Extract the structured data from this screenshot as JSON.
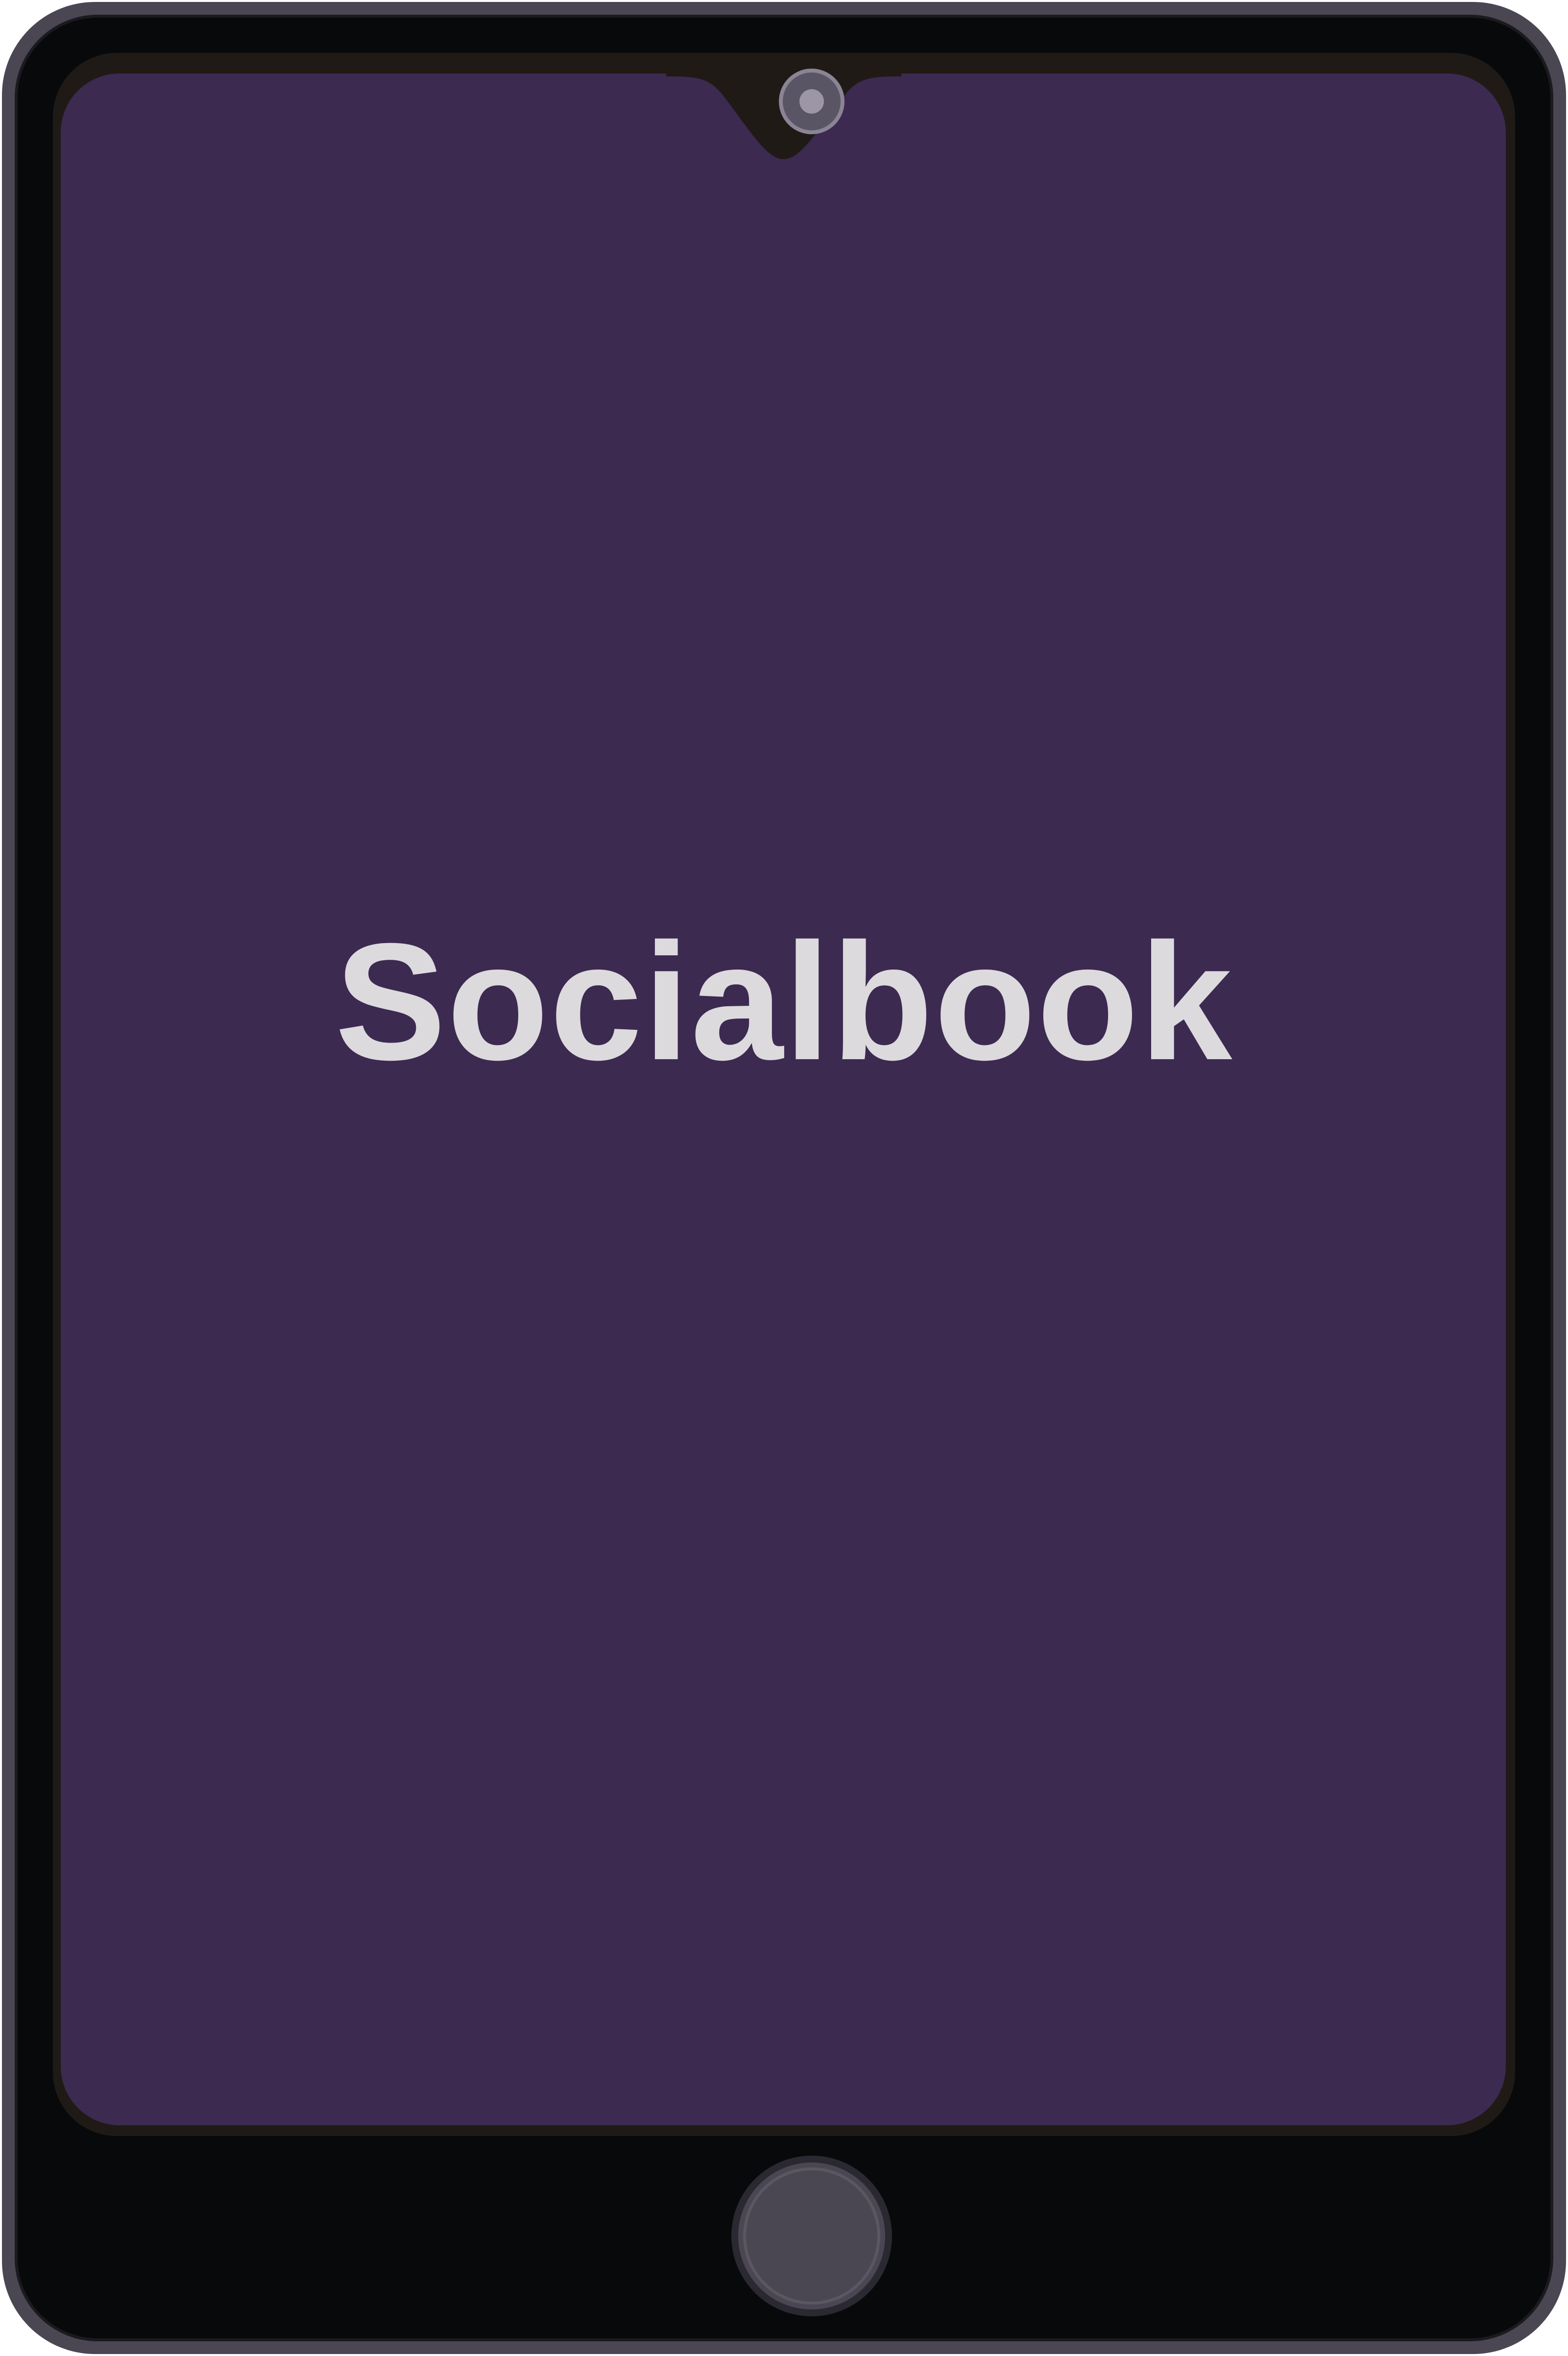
{
  "app": {
    "title": "Socialbook"
  },
  "colors": {
    "screen_background": "#3c2a51",
    "title_text": "#dcdadd",
    "device_body": "#08090b",
    "device_edge": "#4a4652"
  },
  "icons": {
    "camera": "front-camera-icon",
    "home": "home-button"
  }
}
